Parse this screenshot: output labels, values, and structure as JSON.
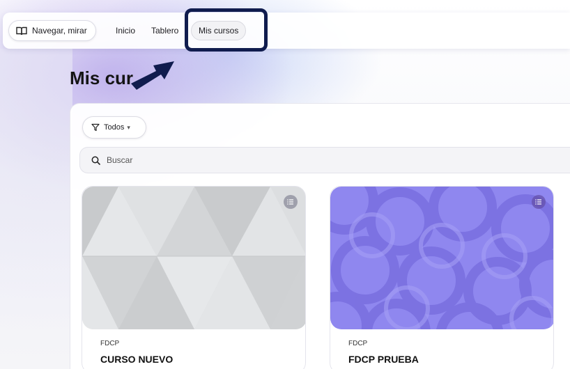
{
  "nav": {
    "browse_label": "Navegar, mirar",
    "home_label": "Inicio",
    "dashboard_label": "Tablero",
    "my_courses_label": "Mis cursos"
  },
  "page": {
    "title": "Mis cur"
  },
  "filter": {
    "label": "Todos",
    "caret": "▾"
  },
  "search": {
    "placeholder": "Buscar"
  },
  "courses": [
    {
      "category": "FDCP",
      "name": "CURSO NUEVO",
      "pattern": "grey-triangles"
    },
    {
      "category": "FDCP",
      "name": "FDCP PRUEBA",
      "pattern": "purple-circles"
    }
  ],
  "colors": {
    "highlight": "#101c4e",
    "purple_pattern": "#8e86ee",
    "grey_pattern": "#d6d8da"
  },
  "icons": {
    "browse": "book-open-icon",
    "filter": "funnel-icon",
    "search": "search-icon",
    "card_menu": "list-menu-icon",
    "annotation": "arrow-icon"
  }
}
